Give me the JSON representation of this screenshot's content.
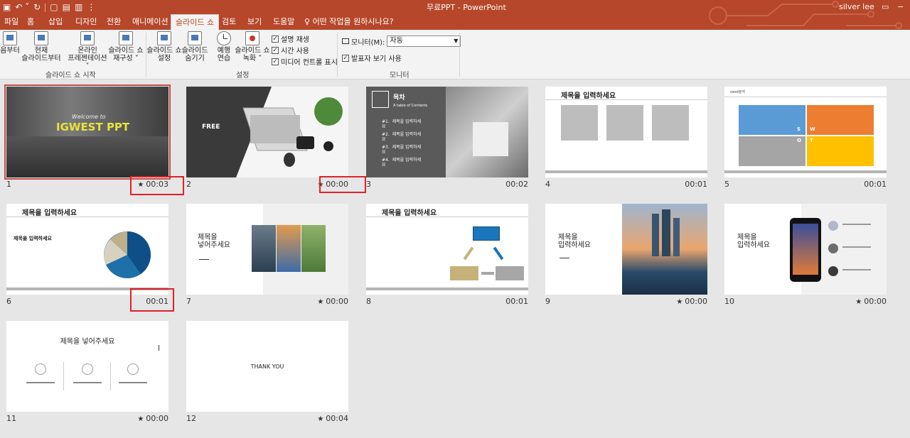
{
  "titlebar": {
    "title": "무료PPT  -  PowerPoint",
    "user": "silver lee",
    "qat_icons": [
      "save-icon",
      "undo-icon",
      "redo-icon",
      "repeat-icon"
    ]
  },
  "tabs": [
    "파일",
    "홈",
    "삽입",
    "디자인",
    "전환",
    "애니메이션",
    "슬라이드 쇼",
    "검토",
    "보기",
    "도움말",
    "어떤 작업을 원하시나요?"
  ],
  "ribbon": {
    "groups": {
      "start": "슬라이드 쇼 시작",
      "setup": "설정",
      "monitors": "모니터"
    },
    "buttons": {
      "from_beginning": "음부터",
      "from_current_1": "현재",
      "from_current_2": "슬라이드부터",
      "online_1": "온라인",
      "online_2": "프레젠테이션 ˅",
      "custom_1": "슬라이드 쇼",
      "custom_2": "재구성 ˅",
      "setup_1": "슬라이드 쇼",
      "setup_2": "설정",
      "hide_1": "슬라이드",
      "hide_2": "숨기기",
      "rehearse_1": "예행",
      "rehearse_2": "연습",
      "record_1": "슬라이드 쇼",
      "record_2": "녹화 ˅"
    },
    "checks": {
      "narration": "설명 재생",
      "timings": "시간 사용",
      "media_controls": "미디어 컨트롤 표시",
      "presenter_view": "발표자 보기 사용"
    },
    "monitor_label": "모니터(M):",
    "monitor_value": "자동"
  },
  "slides": [
    {
      "num": "1",
      "time": "00:03",
      "star": true,
      "text1": "Welcome to",
      "text2": "IGWEST PPT"
    },
    {
      "num": "2",
      "time": "00:00",
      "star": true,
      "text1": "FREE"
    },
    {
      "num": "3",
      "time": "00:02",
      "star": false,
      "title": "목차",
      "subtitle": "A table of Contents",
      "items": [
        "#1.  제목을 입력하세\n요",
        "#2.  제목을 입력하세\n요",
        "#3.  제목을 입력하세\n요",
        "#4.  제목을 입력하세\n요"
      ]
    },
    {
      "num": "4",
      "time": "00:01",
      "star": false,
      "title": "제목을 입력하세요"
    },
    {
      "num": "5",
      "time": "00:01",
      "star": false,
      "title": "swot분석",
      "letters": [
        "S",
        "W",
        "O",
        "T"
      ]
    },
    {
      "num": "6",
      "time": "00:01",
      "star": false,
      "title": "제목을 입력하세요",
      "subtitle": "제목을 입력하세요"
    },
    {
      "num": "7",
      "time": "00:00",
      "star": true,
      "title": "제목을\n넣어주세요"
    },
    {
      "num": "8",
      "time": "00:01",
      "star": false,
      "title": "제목을 입력하세요"
    },
    {
      "num": "9",
      "time": "00:00",
      "star": true,
      "title": "제목을\n입력하세요"
    },
    {
      "num": "10",
      "time": "00:00",
      "star": true,
      "title": "제목을\n입력하세요"
    },
    {
      "num": "11",
      "time": "00:00",
      "star": true,
      "title": "제목을 넣어주세요"
    },
    {
      "num": "12",
      "time": "00:04",
      "star": true,
      "title": "THANK YOU"
    }
  ],
  "colors": {
    "accent": "#b7472a",
    "highlight_box": "#e0202a"
  }
}
